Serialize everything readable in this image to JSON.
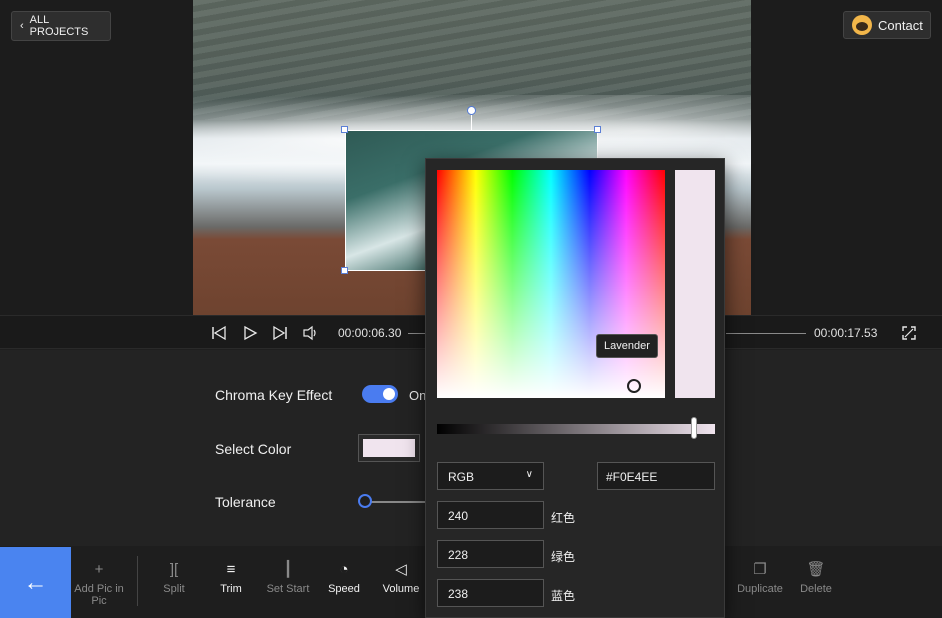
{
  "header": {
    "back_label": "ALL PROJECTS",
    "contact_label": "Contact"
  },
  "player": {
    "current_time": "00:00:06.30",
    "total_time": "00:00:17.53"
  },
  "properties": {
    "chroma_label": "Chroma Key Effect",
    "chroma_state": "On",
    "select_color_label": "Select Color",
    "tolerance_label": "Tolerance",
    "selected_color": "#F0E4EE"
  },
  "color_picker": {
    "tooltip": "Lavender",
    "mode": "RGB",
    "hex": "#F0E4EE",
    "red": "240",
    "green": "228",
    "blue": "238",
    "red_label": "红色",
    "green_label": "绿色",
    "blue_label": "蓝色",
    "color_value": "#F0E4EE"
  },
  "toolbar": {
    "items": [
      {
        "label": "Add Pic in Pic",
        "icon": "plus-icon"
      },
      {
        "label": "Split",
        "icon": "split-icon"
      },
      {
        "label": "Trim",
        "icon": "trim-icon"
      },
      {
        "label": "Set Start",
        "icon": "set-start-icon"
      },
      {
        "label": "Speed",
        "icon": "speed-icon"
      },
      {
        "label": "Volume",
        "icon": "volume-icon"
      },
      {
        "label": "Duplicate",
        "icon": "duplicate-icon"
      },
      {
        "label": "Delete",
        "icon": "delete-icon"
      }
    ]
  },
  "colors": {
    "accent": "#4A84F0"
  }
}
